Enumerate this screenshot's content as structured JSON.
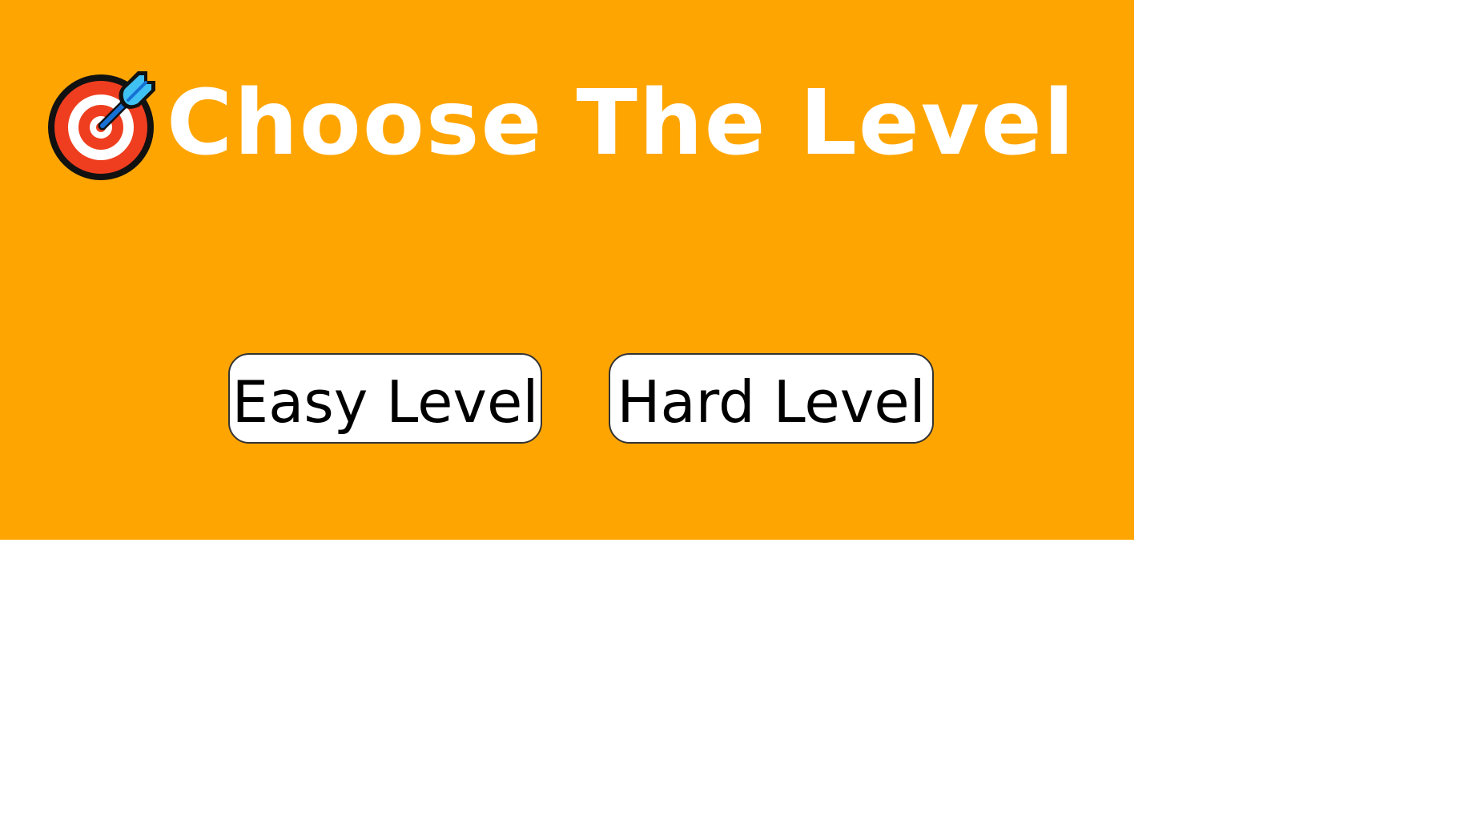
{
  "screen": {
    "background_color": "#ffa502",
    "title": "Choose The Level",
    "title_icon": "direct-hit-target-icon"
  },
  "buttons": {
    "easy_label": "Easy Level",
    "hard_label": "Hard Level"
  }
}
